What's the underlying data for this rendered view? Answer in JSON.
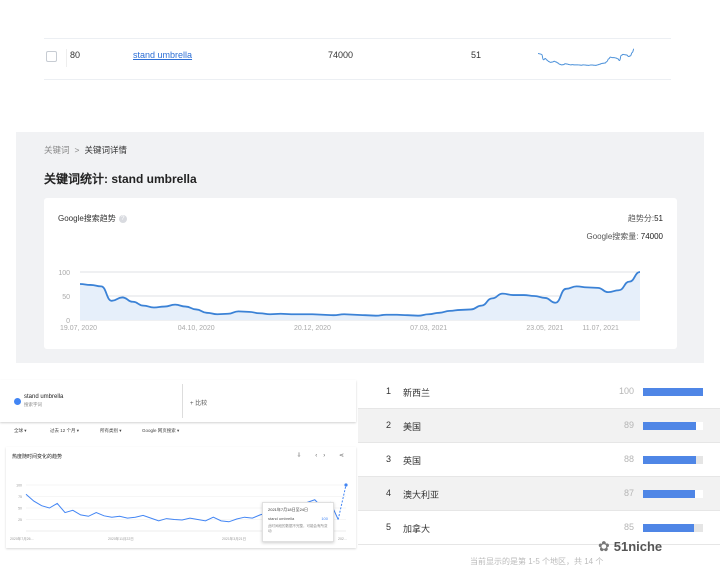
{
  "keyword_row": {
    "rank": "80",
    "keyword": "stand umbrella",
    "search_volume": "74000",
    "trend_score": "51"
  },
  "detail": {
    "breadcrumb_root": "关键词",
    "breadcrumb_sep": ">",
    "breadcrumb_current": "关键词详情",
    "title": "关键词统计: stand umbrella",
    "card_title": "Google搜索趋势",
    "score_label": "趋势分:",
    "score_value": "51",
    "volume_label": "Google搜索量:",
    "volume_value": "74000",
    "accent": "#3b82d6"
  },
  "chart_data": {
    "type": "area",
    "title": "Google搜索趋势",
    "y_ticks": [
      "100",
      "50",
      "0"
    ],
    "ylim": [
      0,
      100
    ],
    "x_tick_labels": [
      "19.07, 2020",
      "04.10, 2020",
      "20.12, 2020",
      "07.03, 2021",
      "23.05, 2021",
      "11.07, 2021"
    ],
    "x_tick_positions": [
      0,
      11,
      22,
      33,
      44,
      51
    ],
    "values": [
      75,
      73,
      70,
      40,
      47,
      38,
      30,
      26,
      28,
      32,
      28,
      22,
      15,
      12,
      13,
      18,
      17,
      14,
      12,
      13,
      12,
      12,
      12,
      11,
      10,
      12,
      11,
      10,
      9,
      11,
      11,
      10,
      9,
      12,
      15,
      19,
      21,
      22,
      30,
      45,
      55,
      52,
      52,
      50,
      46,
      36,
      65,
      70,
      68,
      67,
      58,
      62,
      80,
      100
    ],
    "grid": true
  },
  "trends": {
    "term": "stand umbrella",
    "term_sub": "搜索字词",
    "compare": "+ 比较",
    "filters": [
      "全球 ▾",
      "过去 12 个月 ▾",
      "所有类别 ▾",
      "Google 网页搜索 ▾"
    ],
    "panel_title": "热度随时间变化的趋势",
    "icons": "⇩ ‹› ⋖",
    "tooltip_date": "2021年7月18日至24日",
    "tooltip_term": "stand umbrella",
    "tooltip_value": "100",
    "tooltip_note": "此时间段的数据不完整，可能会有所变动",
    "y_ticks": [
      "100",
      "75",
      "50",
      "25"
    ],
    "x_labels": [
      "2020年7月26...",
      "2020年11月22日",
      "2021年3月21日",
      "202..."
    ],
    "values": [
      80,
      65,
      55,
      50,
      60,
      40,
      45,
      35,
      32,
      40,
      33,
      30,
      32,
      28,
      30,
      34,
      28,
      22,
      27,
      25,
      24,
      28,
      25,
      22,
      30,
      22,
      20,
      26,
      30,
      28,
      35,
      40,
      33,
      45,
      50,
      58,
      62,
      68,
      50,
      62,
      25,
      100
    ],
    "accent": "#4285f4"
  },
  "regions": [
    {
      "rank": "1",
      "name": "新西兰",
      "value": "100",
      "pct": 100
    },
    {
      "rank": "2",
      "name": "美国",
      "value": "89",
      "pct": 89
    },
    {
      "rank": "3",
      "name": "英国",
      "value": "88",
      "pct": 88
    },
    {
      "rank": "4",
      "name": "澳大利亚",
      "value": "87",
      "pct": 87
    },
    {
      "rank": "5",
      "name": "加拿大",
      "value": "85",
      "pct": 85
    }
  ],
  "footnote": "当前显示的是第 1-5 个地区，共 14 个",
  "watermark": "51niche"
}
